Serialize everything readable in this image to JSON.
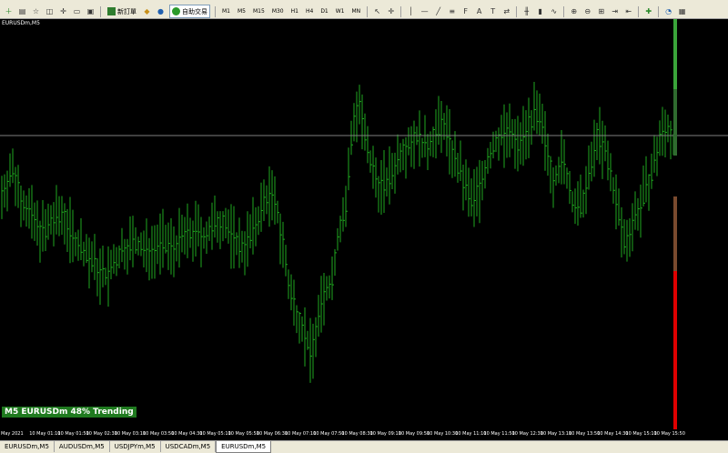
{
  "toolbar": {
    "new_order_label": "新訂單",
    "auto_trade_label": "自助交易",
    "timeframes": [
      "M1",
      "M5",
      "M15",
      "M30",
      "H1",
      "H4",
      "D1",
      "W1",
      "MN"
    ]
  },
  "chart": {
    "title": "EURUSDm,M5",
    "trend_label": "M5 EURUSDm 48% Trending",
    "time_labels": [
      "May 2021",
      "10 May 01:10",
      "10 May 01:50",
      "10 May 02:30",
      "10 May 03:10",
      "10 May 03:50",
      "10 May 04:30",
      "10 May 05:10",
      "10 May 05:50",
      "10 May 06:30",
      "10 May 07:10",
      "10 May 07:50",
      "10 May 08:30",
      "10 May 09:10",
      "10 May 09:50",
      "10 May 10:30",
      "10 May 11:10",
      "10 May 11:50",
      "10 May 12:30",
      "10 May 13:10",
      "10 May 13:50",
      "10 May 14:30",
      "10 May 15:10",
      "10 May 15:50"
    ],
    "colors": {
      "background": "#000000",
      "bars": "#1fa81f",
      "hline": "#808080",
      "strength_green": "#3aa53a",
      "strength_brown": "#7a4a2e",
      "strength_red": "#e00000"
    }
  },
  "tabs": [
    {
      "label": "EURUSDm,M5",
      "active": false
    },
    {
      "label": "AUDUSDm,M5",
      "active": false
    },
    {
      "label": "USDJPYm,M5",
      "active": false
    },
    {
      "label": "USDCADm,M5",
      "active": false
    },
    {
      "label": "EURUSDm,M5",
      "active": true
    }
  ]
}
